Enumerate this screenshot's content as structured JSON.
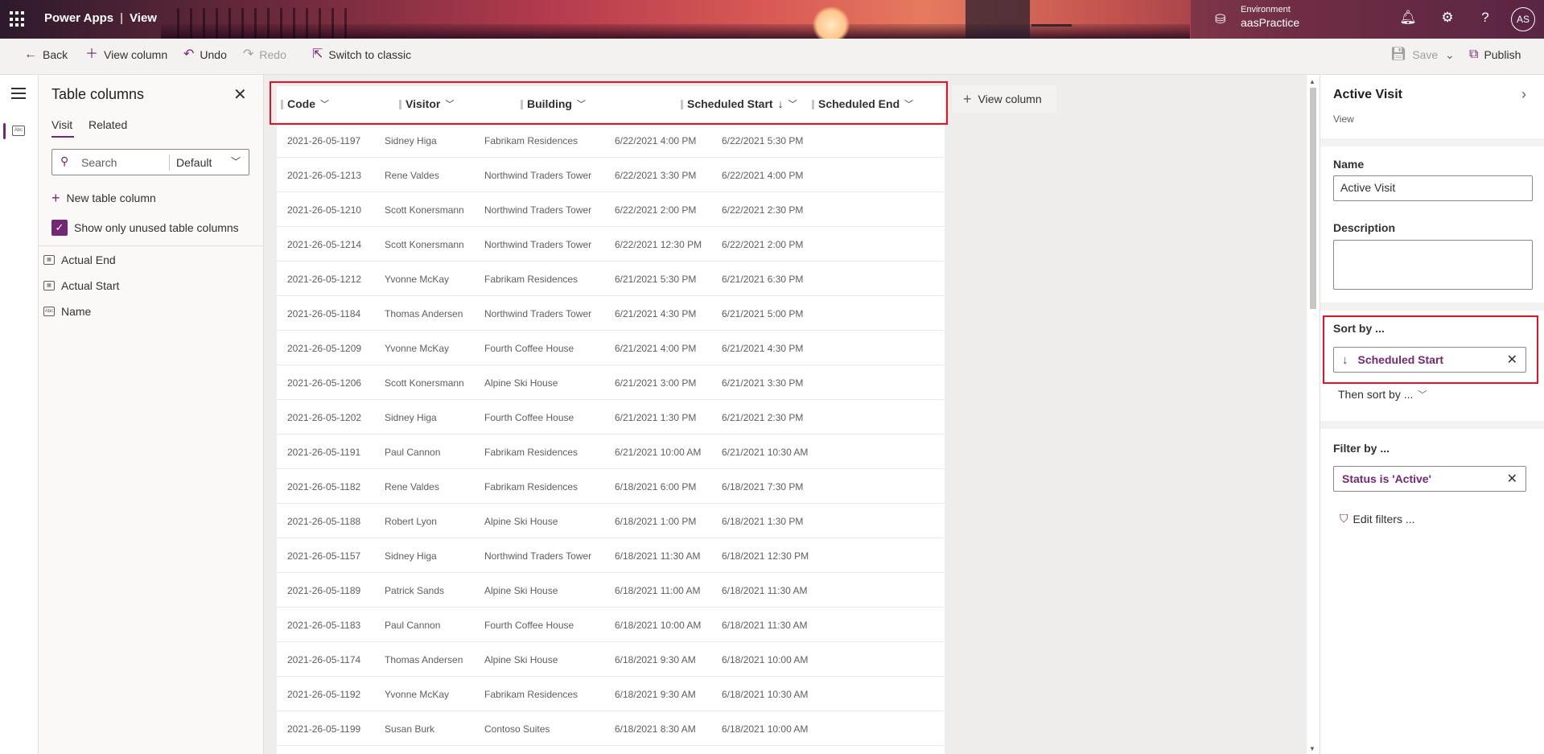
{
  "header": {
    "app_name": "Power Apps",
    "separator": "|",
    "page": "View",
    "environment_label": "Environment",
    "environment_name": "aasPractice",
    "avatar_initials": "AS"
  },
  "commands": {
    "back": "Back",
    "view_column": "View column",
    "undo": "Undo",
    "redo": "Redo",
    "switch_classic": "Switch to classic",
    "save": "Save",
    "publish": "Publish"
  },
  "column_panel": {
    "title": "Table columns",
    "tabs": [
      "Visit",
      "Related"
    ],
    "search_placeholder": "Search",
    "filter_value": "Default",
    "new_column": "New table column",
    "checkbox_label": "Show only unused table columns",
    "fields": [
      "Actual End",
      "Actual Start",
      "Name"
    ]
  },
  "grid": {
    "columns": [
      "Code",
      "Visitor",
      "Building",
      "Scheduled Start",
      "Scheduled End"
    ],
    "sort_indicator": "↓",
    "add_column": "View column",
    "rows": [
      [
        "2021-26-05-1197",
        "Sidney Higa",
        "Fabrikam Residences",
        "6/22/2021 4:00 PM",
        "6/22/2021 5:30 PM"
      ],
      [
        "2021-26-05-1213",
        "Rene Valdes",
        "Northwind Traders Tower",
        "6/22/2021 3:30 PM",
        "6/22/2021 4:00 PM"
      ],
      [
        "2021-26-05-1210",
        "Scott Konersmann",
        "Northwind Traders Tower",
        "6/22/2021 2:00 PM",
        "6/22/2021 2:30 PM"
      ],
      [
        "2021-26-05-1214",
        "Scott Konersmann",
        "Northwind Traders Tower",
        "6/22/2021 12:30 PM",
        "6/22/2021 2:00 PM"
      ],
      [
        "2021-26-05-1212",
        "Yvonne McKay",
        "Fabrikam Residences",
        "6/21/2021 5:30 PM",
        "6/21/2021 6:30 PM"
      ],
      [
        "2021-26-05-1184",
        "Thomas Andersen",
        "Northwind Traders Tower",
        "6/21/2021 4:30 PM",
        "6/21/2021 5:00 PM"
      ],
      [
        "2021-26-05-1209",
        "Yvonne McKay",
        "Fourth Coffee House",
        "6/21/2021 4:00 PM",
        "6/21/2021 4:30 PM"
      ],
      [
        "2021-26-05-1206",
        "Scott Konersmann",
        "Alpine Ski House",
        "6/21/2021 3:00 PM",
        "6/21/2021 3:30 PM"
      ],
      [
        "2021-26-05-1202",
        "Sidney Higa",
        "Fourth Coffee House",
        "6/21/2021 1:30 PM",
        "6/21/2021 2:30 PM"
      ],
      [
        "2021-26-05-1191",
        "Paul Cannon",
        "Fabrikam Residences",
        "6/21/2021 10:00 AM",
        "6/21/2021 10:30 AM"
      ],
      [
        "2021-26-05-1182",
        "Rene Valdes",
        "Fabrikam Residences",
        "6/18/2021 6:00 PM",
        "6/18/2021 7:30 PM"
      ],
      [
        "2021-26-05-1188",
        "Robert Lyon",
        "Alpine Ski House",
        "6/18/2021 1:00 PM",
        "6/18/2021 1:30 PM"
      ],
      [
        "2021-26-05-1157",
        "Sidney Higa",
        "Northwind Traders Tower",
        "6/18/2021 11:30 AM",
        "6/18/2021 12:30 PM"
      ],
      [
        "2021-26-05-1189",
        "Patrick Sands",
        "Alpine Ski House",
        "6/18/2021 11:00 AM",
        "6/18/2021 11:30 AM"
      ],
      [
        "2021-26-05-1183",
        "Paul Cannon",
        "Fourth Coffee House",
        "6/18/2021 10:00 AM",
        "6/18/2021 11:30 AM"
      ],
      [
        "2021-26-05-1174",
        "Thomas Andersen",
        "Alpine Ski House",
        "6/18/2021 9:30 AM",
        "6/18/2021 10:00 AM"
      ],
      [
        "2021-26-05-1192",
        "Yvonne McKay",
        "Fabrikam Residences",
        "6/18/2021 9:30 AM",
        "6/18/2021 10:30 AM"
      ],
      [
        "2021-26-05-1199",
        "Susan Burk",
        "Contoso Suites",
        "6/18/2021 8:30 AM",
        "6/18/2021 10:00 AM"
      ]
    ]
  },
  "properties": {
    "title": "Active Visit",
    "subtitle": "View",
    "name_label": "Name",
    "name_value": "Active Visit",
    "description_label": "Description",
    "description_value": "",
    "sort_label": "Sort by ...",
    "sort_value": "Scheduled Start",
    "then_sort": "Then sort by ...",
    "filter_label": "Filter by ...",
    "filter_value": "Status is 'Active'",
    "edit_filters": "Edit filters ..."
  },
  "colors": {
    "accent": "#742774",
    "highlight": "#e81123"
  }
}
